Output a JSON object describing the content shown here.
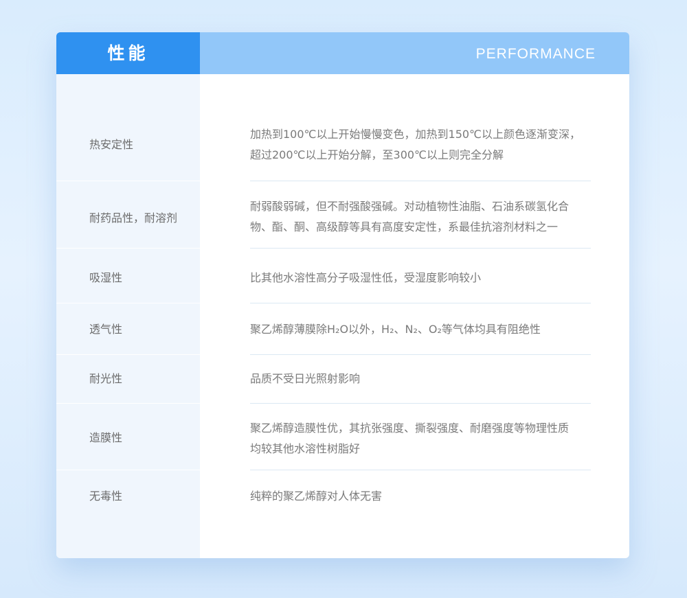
{
  "header": {
    "title": "性能",
    "subtitle": "PERFORMANCE"
  },
  "rows": [
    {
      "label": "热安定性",
      "lines": [
        "加热到100℃以上开始慢慢变色，加热到150℃以上颜色逐渐变深，",
        "超过200℃以上开始分解，至300℃以上则完全分解"
      ]
    },
    {
      "label": "耐药品性，耐溶剂",
      "lines": [
        "耐弱酸弱碱，但不耐强酸强碱。对动植物性油脂、石油系碳氢化合",
        "物、酯、酮、高级醇等具有高度安定性，系最佳抗溶剂材料之一"
      ]
    },
    {
      "label": "吸湿性",
      "lines": [
        "比其他水溶性高分子吸湿性低，受湿度影响较小"
      ]
    },
    {
      "label": "透气性",
      "lines": [
        "聚乙烯醇薄膜除H₂O以外，H₂、N₂、O₂等气体均具有阻绝性"
      ]
    },
    {
      "label": "耐光性",
      "lines": [
        "品质不受日光照射影响"
      ]
    },
    {
      "label": "造膜性",
      "lines": [
        "聚乙烯醇造膜性优，其抗张强度、撕裂强度、耐磨强度等物理性质",
        "均较其他水溶性树脂好"
      ]
    },
    {
      "label": "无毒性",
      "lines": [
        "纯粹的聚乙烯醇对人体无害"
      ]
    }
  ]
}
